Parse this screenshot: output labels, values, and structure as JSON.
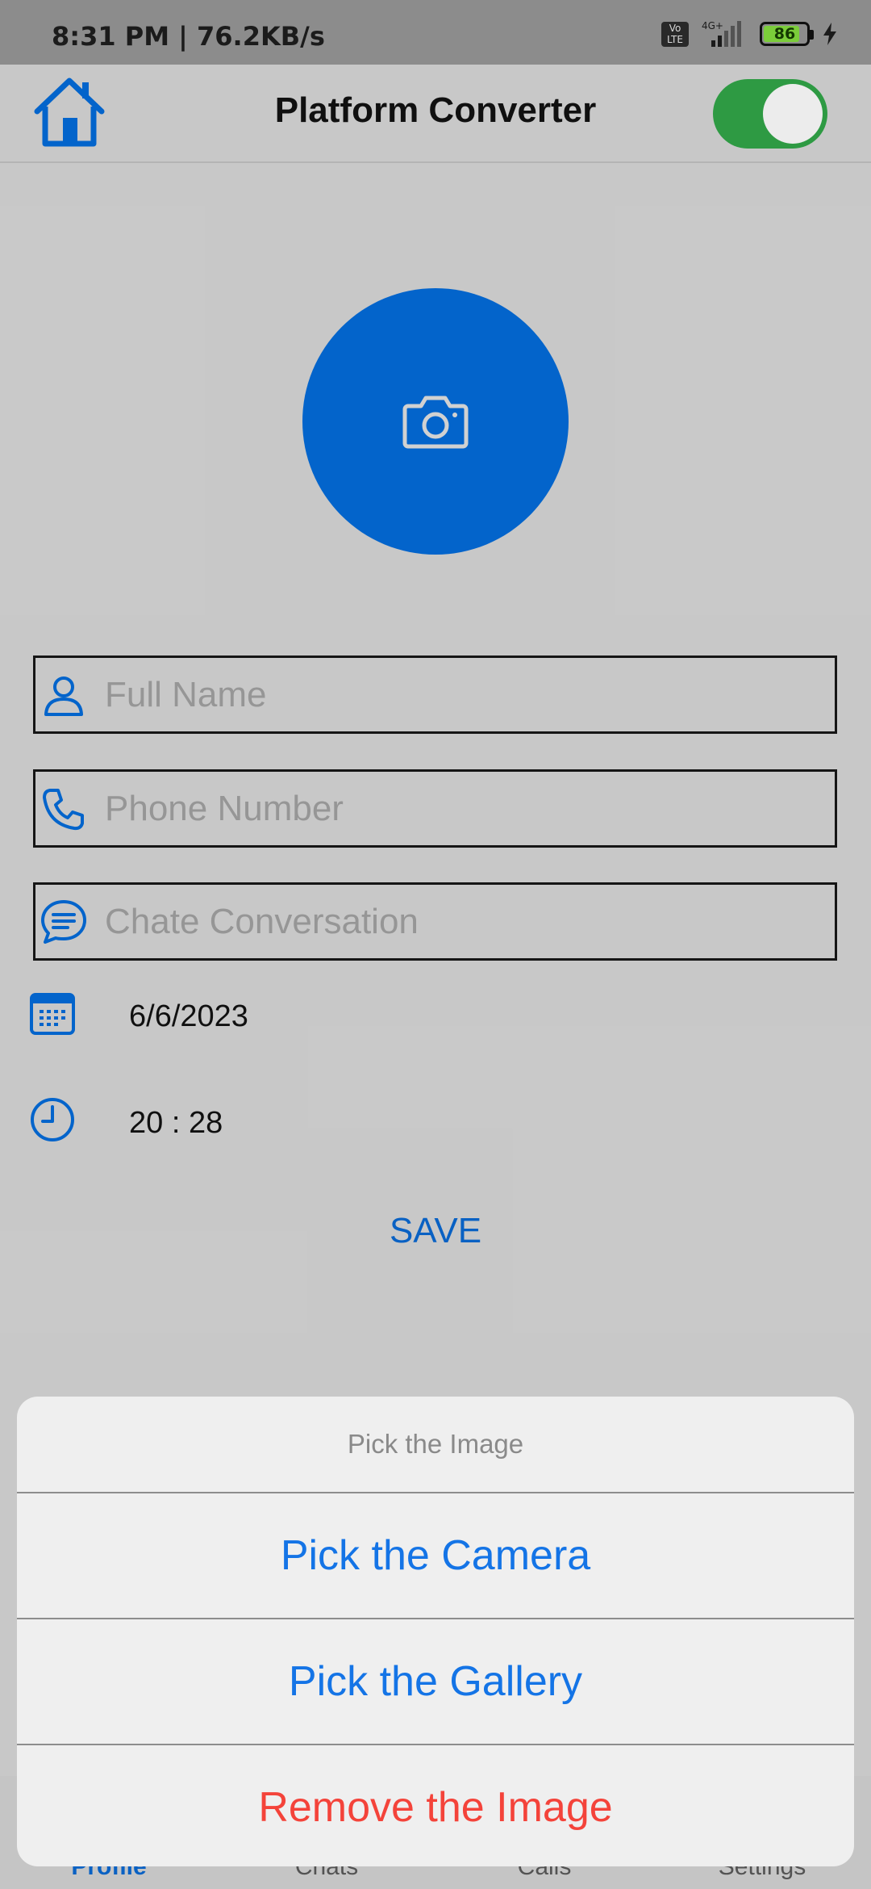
{
  "status_bar": {
    "time": "8:31 PM | 76.2KB/s",
    "network_label": "Vo\nLTE",
    "network_type": "4G+",
    "battery": "86"
  },
  "app_bar": {
    "title": "Platform Converter",
    "toggle_on": true
  },
  "form": {
    "full_name_placeholder": "Full Name",
    "phone_placeholder": "Phone Number",
    "chat_placeholder": "Chate Conversation",
    "date": "6/6/2023",
    "time": "20 : 28",
    "save_label": "SAVE"
  },
  "bottom_nav": {
    "items": [
      "Profile",
      "Chats",
      "Calls",
      "Settings"
    ],
    "active": "Profile"
  },
  "action_sheet": {
    "title": "Pick the Image",
    "camera": "Pick the Camera",
    "gallery": "Pick the Gallery",
    "remove": "Remove the Image"
  },
  "colors": {
    "primary": "#0466d0",
    "toggle": "#2f9e45",
    "destructive": "#f4433a",
    "sheet_action": "#1474e6"
  },
  "icons": [
    "home-icon",
    "camera-icon",
    "person-icon",
    "phone-icon",
    "chat-icon",
    "calendar-icon",
    "clock-icon"
  ]
}
